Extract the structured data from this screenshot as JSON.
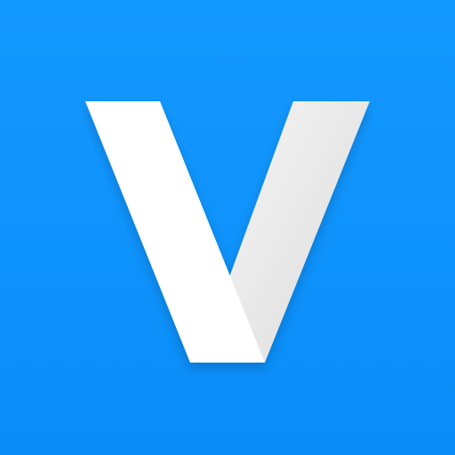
{
  "icon": {
    "glyph": "v-logo-icon",
    "colors": {
      "background_top": "#1499FF",
      "background_bottom": "#0A8CF8",
      "letter_primary": "#FFFFFF",
      "letter_shade_light": "#F4F4F4",
      "letter_shade_dark": "#DCDCDC"
    }
  }
}
